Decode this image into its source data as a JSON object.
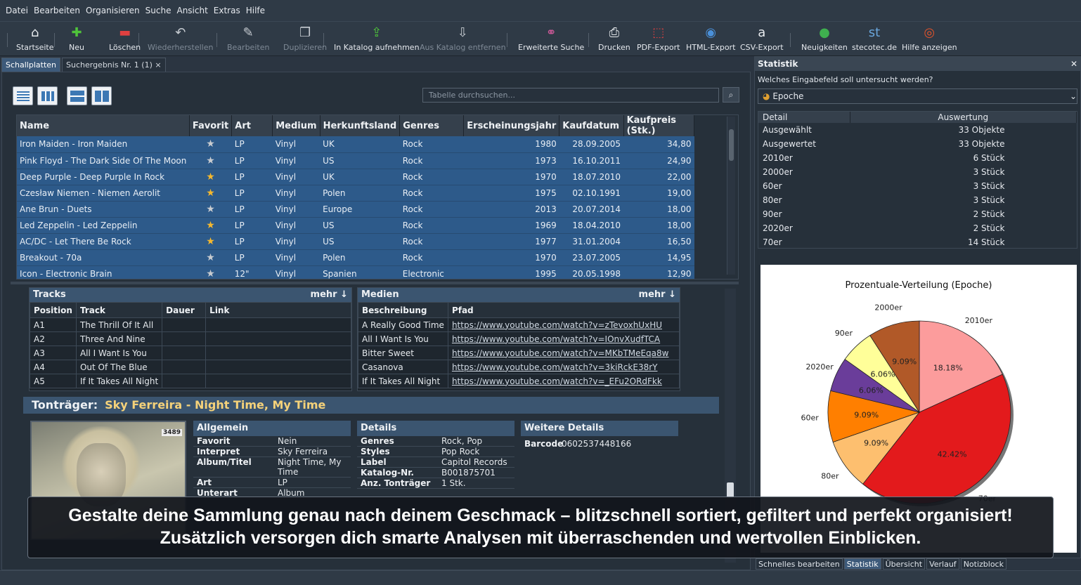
{
  "menu": [
    "Datei",
    "Bearbeiten",
    "Organisieren",
    "Suche",
    "Ansicht",
    "Extras",
    "Hilfe"
  ],
  "toolbar": [
    {
      "label": "Startseite",
      "icon": "home-icon",
      "glyph": "⌂",
      "color": "#e9ecef",
      "disabled": false
    },
    {
      "label": "Neu",
      "icon": "add-icon",
      "glyph": "✚",
      "color": "#4fc43a",
      "disabled": false
    },
    {
      "label": "Löschen",
      "icon": "delete-icon",
      "glyph": "▬",
      "color": "#e04040",
      "disabled": false
    },
    {
      "label": "Wiederherstellen",
      "icon": "undo-icon",
      "glyph": "↶",
      "color": "#c7ccd2",
      "disabled": true
    },
    {
      "label": "Bearbeiten",
      "icon": "edit-icon",
      "glyph": "✎",
      "color": "#c7ccd2",
      "disabled": true
    },
    {
      "label": "Duplizieren",
      "icon": "duplicate-icon",
      "glyph": "❐",
      "color": "#c7ccd2",
      "disabled": true
    },
    {
      "label": "In Katalog aufnehmen",
      "icon": "catalog-add-icon",
      "glyph": "⇪",
      "color": "#4fc43a",
      "disabled": false
    },
    {
      "label": "Aus Katalog entfernen",
      "icon": "catalog-remove-icon",
      "glyph": "⇩",
      "color": "#c7ccd2",
      "disabled": true
    },
    {
      "label": "Erweiterte Suche",
      "icon": "binoculars-icon",
      "glyph": "⚭",
      "color": "#d05a9a",
      "disabled": false
    },
    {
      "label": "Drucken",
      "icon": "printer-icon",
      "glyph": "⎙",
      "color": "#e9ecef",
      "disabled": false
    },
    {
      "label": "PDF-Export",
      "icon": "pdf-icon",
      "glyph": "⬚",
      "color": "#e04040",
      "disabled": false
    },
    {
      "label": "HTML-Export",
      "icon": "html-icon",
      "glyph": "◉",
      "color": "#4a90d9",
      "disabled": false
    },
    {
      "label": "CSV-Export",
      "icon": "csv-icon",
      "glyph": "a",
      "color": "#e9ecef",
      "disabled": false
    },
    {
      "label": "Neuigkeiten",
      "icon": "globe-icon",
      "glyph": "●",
      "color": "#3fb04f",
      "disabled": false
    },
    {
      "label": "stecotec.de",
      "icon": "stecotec-icon",
      "glyph": "st",
      "color": "#6aa6dc",
      "disabled": false
    },
    {
      "label": "Hilfe anzeigen",
      "icon": "help-icon",
      "glyph": "◎",
      "color": "#e2532b",
      "disabled": false
    }
  ],
  "tabs": {
    "main": "Schallplatten",
    "search": "Suchergebnis Nr. 1 (1)",
    "close": "×"
  },
  "search": {
    "placeholder": "Tabelle durchsuchen...",
    "icon": "⌕"
  },
  "grid": {
    "columns": [
      "Name",
      "Favorit",
      "Art",
      "Medium",
      "Herkunftsland",
      "Genres",
      "Erscheinungsjahr",
      "Kaufdatum",
      "Kaufpreis (Stk.)"
    ],
    "rows": [
      {
        "name": "Iron Maiden - Iron Maiden",
        "fav": false,
        "art": "LP",
        "medium": "Vinyl",
        "land": "UK",
        "genre": "Rock",
        "jahr": "1980",
        "datum": "28.09.2005",
        "preis": "34,80"
      },
      {
        "name": "Pink Floyd - The Dark Side Of The Moon",
        "fav": false,
        "art": "LP",
        "medium": "Vinyl",
        "land": "US",
        "genre": "Rock",
        "jahr": "1973",
        "datum": "16.10.2011",
        "preis": "24,90"
      },
      {
        "name": "Deep Purple - Deep Purple In Rock",
        "fav": true,
        "art": "LP",
        "medium": "Vinyl",
        "land": "UK",
        "genre": "Rock",
        "jahr": "1970",
        "datum": "18.07.2010",
        "preis": "22,00"
      },
      {
        "name": "Czesław Niemen - Niemen Aerolit",
        "fav": true,
        "art": "LP",
        "medium": "Vinyl",
        "land": "Polen",
        "genre": "Rock",
        "jahr": "1975",
        "datum": "02.10.1991",
        "preis": "19,00"
      },
      {
        "name": "Ane Brun - Duets",
        "fav": false,
        "art": "LP",
        "medium": "Vinyl",
        "land": "Europe",
        "genre": "Rock",
        "jahr": "2013",
        "datum": "20.07.2014",
        "preis": "18,00"
      },
      {
        "name": "Led Zeppelin - Led Zeppelin",
        "fav": true,
        "art": "LP",
        "medium": "Vinyl",
        "land": "US",
        "genre": "Rock",
        "jahr": "1969",
        "datum": "18.04.2010",
        "preis": "18,00"
      },
      {
        "name": "AC/DC - Let There Be Rock",
        "fav": true,
        "art": "LP",
        "medium": "Vinyl",
        "land": "US",
        "genre": "Rock",
        "jahr": "1977",
        "datum": "31.01.2004",
        "preis": "16,50"
      },
      {
        "name": "Breakout - 70a",
        "fav": false,
        "art": "LP",
        "medium": "Vinyl",
        "land": "Polen",
        "genre": "Rock",
        "jahr": "1970",
        "datum": "23.07.2005",
        "preis": "14,95"
      },
      {
        "name": "Icon - Electronic Brain",
        "fav": false,
        "art": "12\"",
        "medium": "Vinyl",
        "land": "Spanien",
        "genre": "Electronic",
        "jahr": "1995",
        "datum": "20.05.1998",
        "preis": "12,90"
      }
    ]
  },
  "tracks": {
    "title": "Tracks",
    "more": "mehr ↓",
    "columns": [
      "Position",
      "Track",
      "Dauer",
      "Link"
    ],
    "rows": [
      [
        "A1",
        "The Thrill Of It All"
      ],
      [
        "A2",
        "Three And Nine"
      ],
      [
        "A3",
        "All I Want Is You"
      ],
      [
        "A4",
        "Out Of The Blue"
      ],
      [
        "A5",
        "If It Takes All Night"
      ]
    ]
  },
  "medien": {
    "title": "Medien",
    "more": "mehr ↓",
    "columns": [
      "Beschreibung",
      "Pfad"
    ],
    "rows": [
      [
        "A Really Good Time",
        "https://www.youtube.com/watch?v=zTevoxhUxHU"
      ],
      [
        "All I Want Is You",
        "https://www.youtube.com/watch?v=IOnvXudfTCA"
      ],
      [
        "Bitter Sweet",
        "https://www.youtube.com/watch?v=MKbTMeEqa8w"
      ],
      [
        "Casanova",
        "https://www.youtube.com/watch?v=3kiRckE38rY"
      ],
      [
        "If It Takes All Night",
        "https://www.youtube.com/watch?v=_EFu2ORdFkk"
      ]
    ]
  },
  "traeger": {
    "label": "Tonträger:",
    "title": "Sky Ferreira - Night Time, My Time"
  },
  "cover": {
    "tag": "3489"
  },
  "allgemein": {
    "title": "Allgemein",
    "rows": [
      [
        "Favorit",
        "Nein"
      ],
      [
        "Interpret",
        "Sky Ferreira"
      ],
      [
        "Album/Titel",
        "Night Time, My Time"
      ],
      [
        "Art",
        "LP"
      ],
      [
        "Unterart",
        "Album"
      ]
    ]
  },
  "details": {
    "title": "Details",
    "rows": [
      [
        "Genres",
        "Rock, Pop"
      ],
      [
        "Styles",
        "Pop Rock"
      ],
      [
        "Label",
        "Capitol Records"
      ],
      [
        "Katalog-Nr.",
        "B001875701"
      ],
      [
        "Anz. Tonträger",
        "1 Stk."
      ]
    ]
  },
  "weitere": {
    "title": "Weitere Details",
    "barcode_label": "Barcode",
    "barcode": "0602537448166"
  },
  "overlay": {
    "line1": "Gestalte deine Sammlung genau nach deinem Geschmack – blitzschnell sortiert, gefiltert und perfekt organisiert!",
    "line2": "Zusätzlich versorgen dich smarte Analysen mit überraschenden und wertvollen Einblicken."
  },
  "statistik": {
    "title": "Statistik",
    "close": "✕",
    "question": "Welches Eingabefeld soll untersucht werden?",
    "field": "Epoche",
    "columns": [
      "Detail",
      "Auswertung"
    ],
    "rows": [
      [
        "Ausgewählt",
        "33 Objekte"
      ],
      [
        "Ausgewertet",
        "33 Objekte"
      ],
      [
        "2010er",
        "6 Stück"
      ],
      [
        "2000er",
        "3 Stück"
      ],
      [
        "60er",
        "3 Stück"
      ],
      [
        "80er",
        "3 Stück"
      ],
      [
        "90er",
        "2 Stück"
      ],
      [
        "2020er",
        "2 Stück"
      ],
      [
        "70er",
        "14 Stück"
      ]
    ]
  },
  "chart_data": {
    "type": "pie",
    "title": "Prozentuale-Verteilung (Epoche)",
    "categories": [
      "2010er",
      "70er",
      "80er",
      "60er",
      "2020er",
      "90er",
      "2000er"
    ],
    "values": [
      18.18,
      42.42,
      9.09,
      9.09,
      6.06,
      6.06,
      9.09
    ],
    "labels": [
      "18.18%",
      "42.42%",
      "9.09%",
      "9.09%",
      "6.06%",
      "6.06%",
      "9.09%"
    ],
    "colors": [
      "#fc9c9c",
      "#e31a1c",
      "#fdbf6f",
      "#ff7f00",
      "#6a3d9a",
      "#ffff99",
      "#b15928"
    ]
  },
  "bottom_tabs": [
    "Schnelles bearbeiten",
    "Statistik",
    "Übersicht",
    "Verlauf",
    "Notizblock"
  ]
}
